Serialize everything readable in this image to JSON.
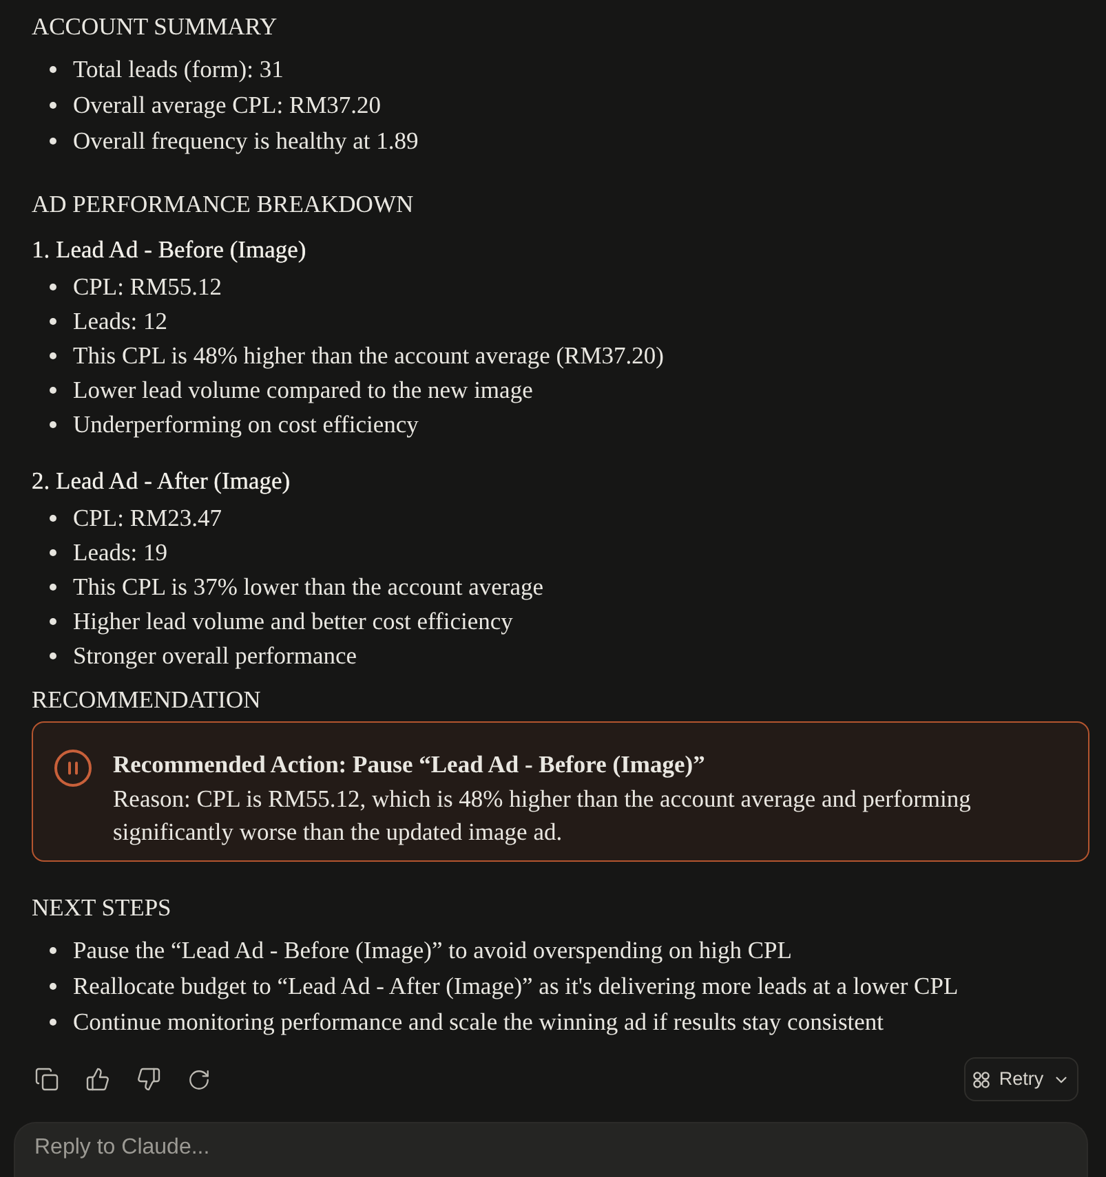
{
  "sections": [
    {
      "kind": "list",
      "heading": "ACCOUNT SUMMARY",
      "items": [
        "Total leads (form): 31",
        "Overall average CPL: RM37.20",
        "Overall frequency is healthy at 1.89"
      ]
    },
    {
      "kind": "breakdown",
      "heading": "AD PERFORMANCE BREAKDOWN",
      "groups": [
        {
          "title": "1. Lead Ad - Before (Image)",
          "items": [
            "CPL: RM55.12",
            "Leads: 12",
            "This CPL is 48% higher than the account average (RM37.20)",
            "Lower lead volume compared to the new image",
            "Underperforming on cost efficiency"
          ]
        },
        {
          "title": "2. Lead Ad - After (Image)",
          "items": [
            "CPL: RM23.47",
            "Leads: 19",
            "This CPL is 37% lower than the account average",
            "Higher lead volume and better cost efficiency",
            "Stronger overall performance"
          ]
        }
      ]
    },
    {
      "kind": "callout",
      "heading": "RECOMMENDATION",
      "callout": {
        "title": "Recommended Action: Pause “Lead Ad - Before (Image)”",
        "body": "Reason: CPL is RM55.12, which is 48% higher than the account average and performing significantly worse than the updated image ad."
      }
    },
    {
      "kind": "list",
      "heading": "NEXT STEPS",
      "items": [
        "Pause the “Lead Ad - Before (Image)” to avoid overspending on high CPL",
        "Reallocate budget to “Lead Ad - After (Image)” as it's delivering more leads at a lower CPL",
        "Continue monitoring performance and scale the winning ad if results stay consistent"
      ]
    }
  ],
  "retry_button": {
    "label": "Retry"
  },
  "reply_field": {
    "placeholder": "Reply to Claude..."
  }
}
